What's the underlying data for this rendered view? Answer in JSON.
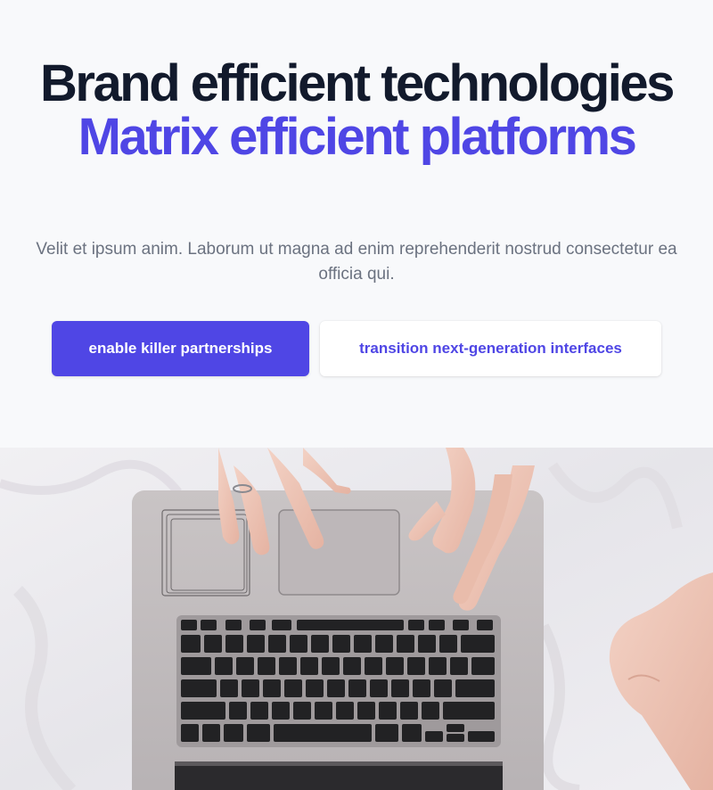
{
  "hero": {
    "title_line1": "Brand efficient technologies",
    "title_line2": "Matrix efficient platforms",
    "subtitle": "Velit et ipsum anim. Laborum ut magna ad enim reprehenderit nostrud consectetur ea officia qui.",
    "primary_button": "enable killer partnerships",
    "secondary_button": "transition next-generation interfaces"
  },
  "colors": {
    "accent": "#4f46e5",
    "heading": "#121a2c",
    "muted": "#6b7280",
    "background": "#f8f9fb"
  },
  "image": {
    "subject": "laptop-keyboard-with-hands"
  }
}
